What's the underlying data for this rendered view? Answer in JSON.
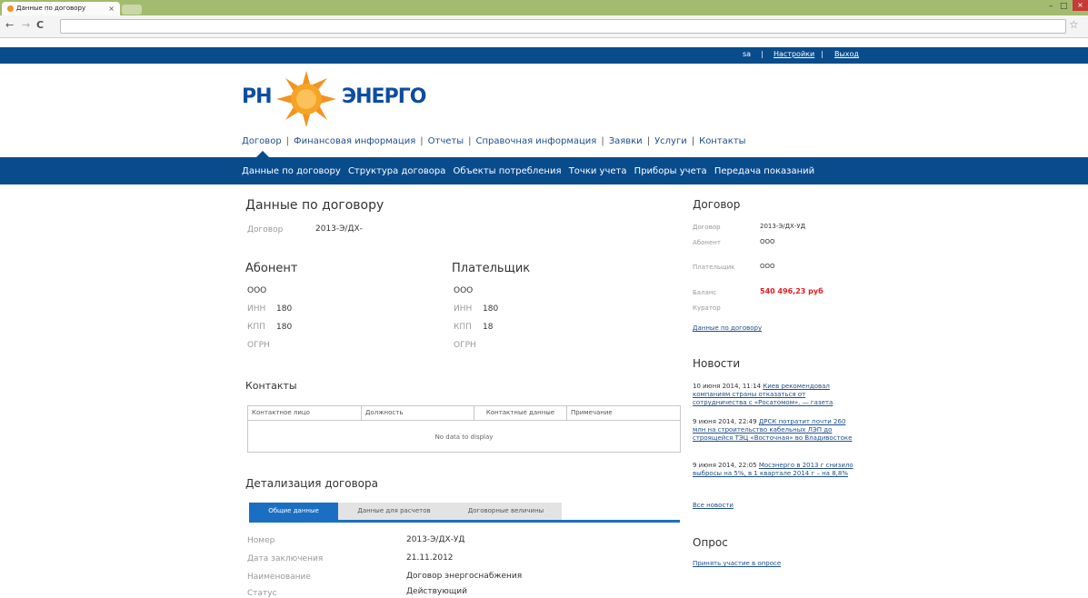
{
  "browser": {
    "tab_title": "Данные по договору",
    "tab_close": "×",
    "back": "←",
    "forward": "→",
    "reload": "C",
    "win_min": "–",
    "win_max": "□",
    "win_close": "×",
    "star": "☆"
  },
  "topbar": {
    "user": "sa",
    "sep": "|",
    "settings": "Настройки",
    "logout": "Выход"
  },
  "logo": {
    "left": "РН",
    "right": "ЭНЕРГО"
  },
  "main_nav": [
    "Договор",
    "Финансовая информация",
    "Отчеты",
    "Справочная информация",
    "Заявки",
    "Услуги",
    "Контакты"
  ],
  "sub_nav": [
    "Данные по договору",
    "Структура договора",
    "Объекты потребления",
    "Точки учета",
    "Приборы учета",
    "Передача показаний"
  ],
  "contract": {
    "title": "Данные по договору",
    "label": "Договор",
    "value": "2013-Э/ДХ-"
  },
  "subscriber": {
    "title": "Абонент",
    "name": "ООО",
    "inn_label": "ИНН",
    "inn": "180",
    "kpp_label": "КПП",
    "kpp": "180",
    "ogrn_label": "ОГРН"
  },
  "payer": {
    "title": "Плательщик",
    "name": "ООО",
    "inn_label": "ИНН",
    "inn": "180",
    "kpp_label": "КПП",
    "kpp": "18",
    "ogrn_label": "ОГРН"
  },
  "contacts": {
    "title": "Контакты",
    "columns": [
      "Контактное лицо",
      "Должность",
      "Контактные данные",
      "Примечание"
    ],
    "empty": "No data to display"
  },
  "details": {
    "title": "Детализация договора",
    "tabs": [
      "Общие данные",
      "Данные для расчетов",
      "Договорные величины"
    ],
    "rows": [
      {
        "label": "Номер",
        "value": "2013-Э/ДХ-УД"
      },
      {
        "label": "Дата заключения",
        "value": "21.11.2012"
      },
      {
        "label": "Наименование",
        "value": "Договор энергоснабжения"
      },
      {
        "label": "Статус",
        "value": "Действующий"
      }
    ]
  },
  "side_contract": {
    "title": "Договор",
    "contract_label": "Договор",
    "contract_value": "2013-Э/ДХ-УД",
    "subscriber_label": "Абонент",
    "subscriber_value": "ООО",
    "payer_label": "Плательщик",
    "payer_value": "ООО",
    "balance_label": "Баланс",
    "balance_value": "540 496,23 руб",
    "curator_label": "Куратор",
    "link": "Данные по договору"
  },
  "news": {
    "title": "Новости",
    "items": [
      {
        "date": "10 июня 2014, 11:14",
        "text": "Киев рекомендовал компаниям страны отказаться от сотрудничества с «Росатомом». — газета"
      },
      {
        "date": "9 июня 2014, 22:49",
        "text": "ДРСК потратит почти 260 млн на строительство кабельных ЛЭП до строящейся ТЭЦ «Восточная» во Владивостоке"
      },
      {
        "date": "9 июня 2014, 22:05",
        "text": "Мосэнерго в 2013 г снизило выбросы на 5%, в 1 квартале 2014 г – на 8,8%"
      }
    ],
    "all_link": "Все новости"
  },
  "poll": {
    "title": "Опрос",
    "link": "Принять участие в опросе"
  },
  "colors": {
    "brand_blue": "#084c8c",
    "balance_red": "#e02020",
    "tab_active": "#1a6fc3",
    "chrome_green": "#a2bb6e"
  }
}
